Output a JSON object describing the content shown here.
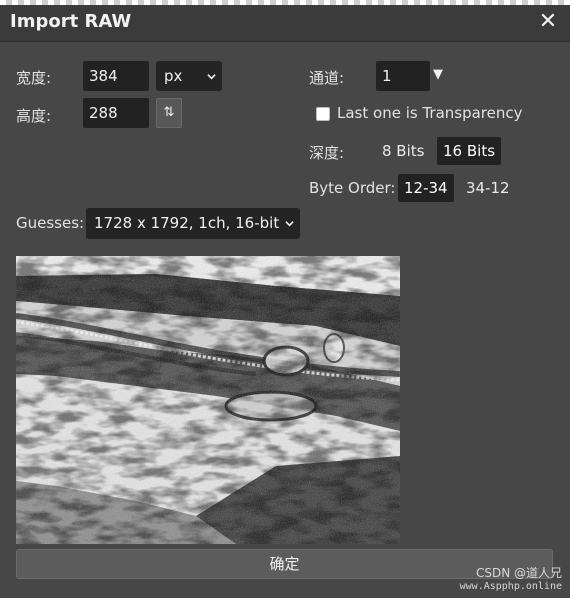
{
  "dialog": {
    "title": "Import RAW",
    "close_icon": "close-icon"
  },
  "width": {
    "label": "宽度:",
    "value": "384",
    "unit": "px"
  },
  "height": {
    "label": "高度:",
    "value": "288",
    "swap_icon": "swap-arrows-icon"
  },
  "channel": {
    "label": "通道:",
    "value": "1",
    "dropdown_icon": "triangle-down-icon"
  },
  "transparency": {
    "label": "Last one is Transparency",
    "checked": false
  },
  "depth": {
    "label": "深度:",
    "options": [
      "8 Bits",
      "16 Bits"
    ],
    "selected": "16 Bits"
  },
  "byte_order": {
    "label": "Byte Order:",
    "options": [
      "12-34",
      "34-12"
    ],
    "selected": "12-34"
  },
  "guesses": {
    "label": "Guesses:",
    "selected": "1728 x 1792, 1ch, 16-bit"
  },
  "confirm_label": "确定",
  "watermark": {
    "line1": "CSDN @道人兄",
    "line2": "www.Aspphp.online"
  },
  "colors": {
    "background": "#474747",
    "titlebar": "#3b3b3b",
    "field": "#222222",
    "button": "#5c5c5c"
  }
}
